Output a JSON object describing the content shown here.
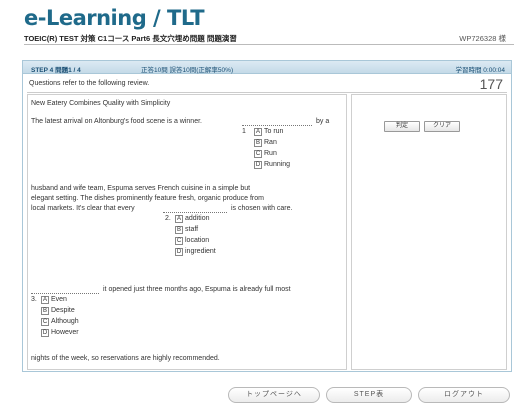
{
  "header": {
    "app_title": "e-Learning / TLT",
    "course_line": "TOEIC(R) TEST 対策 C1コース Part6 長文穴埋め問題 問題演習",
    "user_id": "WP726328 様"
  },
  "step_bar": {
    "step_label": "STEP 4  問題1 / 4",
    "score": "正答10問  誤答10問(正解率50%)",
    "timer": "学習時間  0:00:04"
  },
  "question": {
    "instruction": "Questions refer to the following review.",
    "number": "177"
  },
  "passage": {
    "title": "New Eatery Combines Quality with Simplicity",
    "line1": "The latest arrival on Altonburg's food scene is a winner.",
    "line1_tail": "by a",
    "para2": [
      "husband and wife team, Espuma serves French cuisine in a simple but",
      "elegant setting. The dishes prominently feature fresh, organic produce from",
      "local markets. It's clear that every"
    ],
    "para2_tail": "is chosen with care.",
    "line3_tail": "it opened just three months ago, Espuma is already full most",
    "last_line": "nights of the week, so reservations are highly recommended."
  },
  "blanks": [
    {
      "number": "1",
      "choices": [
        {
          "key": "A",
          "label": "To run"
        },
        {
          "key": "B",
          "label": "Ran"
        },
        {
          "key": "C",
          "label": "Run"
        },
        {
          "key": "D",
          "label": "Running"
        }
      ]
    },
    {
      "number": "2.",
      "choices": [
        {
          "key": "A",
          "label": "addition"
        },
        {
          "key": "B",
          "label": "staff"
        },
        {
          "key": "C",
          "label": "location"
        },
        {
          "key": "D",
          "label": "ingredient"
        }
      ]
    },
    {
      "number": "3.",
      "choices": [
        {
          "key": "A",
          "label": "Even"
        },
        {
          "key": "B",
          "label": "Despite"
        },
        {
          "key": "C",
          "label": "Although"
        },
        {
          "key": "D",
          "label": "However"
        }
      ]
    }
  ],
  "answer_pane": {
    "judge_label": "判定",
    "clear_label": "クリア"
  },
  "footer": {
    "top_page_label": "トップページへ",
    "step_table_label": "STEP表",
    "logout_label": "ログアウト"
  }
}
